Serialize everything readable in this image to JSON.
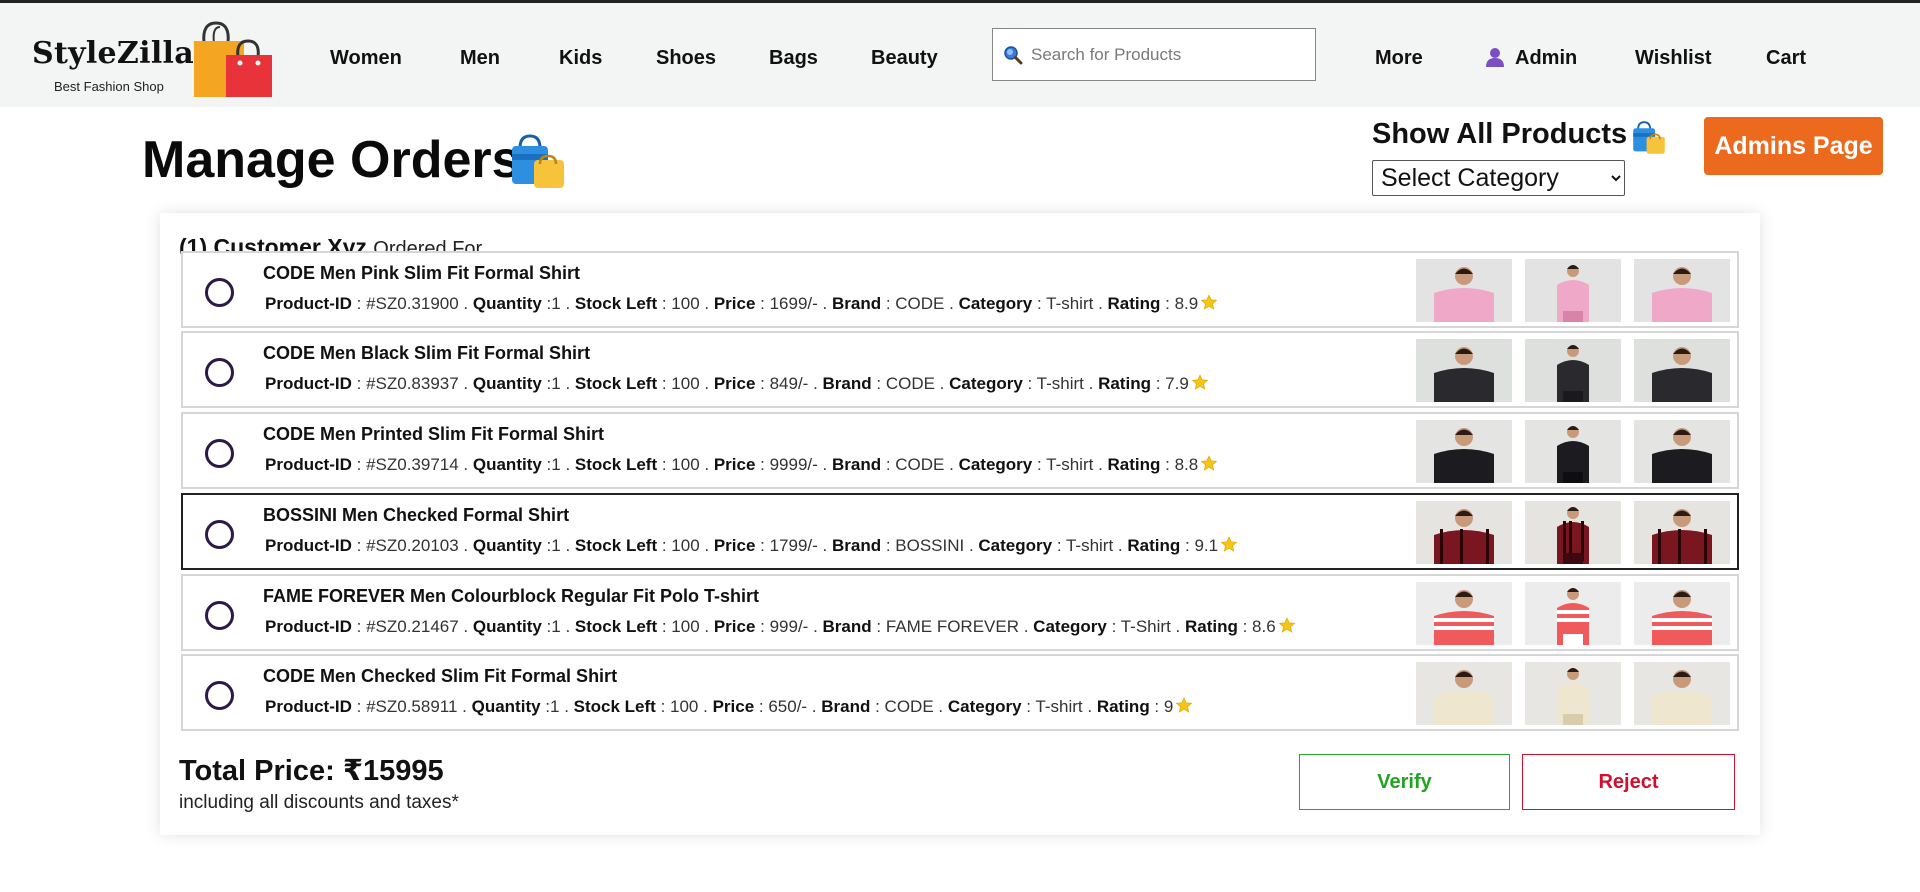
{
  "navbar": {
    "brand_name": "StyleZilla",
    "brand_tagline": "Best Fashion Shop",
    "links": {
      "women": "Women",
      "men": "Men",
      "kids": "Kids",
      "shoes": "Shoes",
      "bags": "Bags",
      "beauty": "Beauty",
      "more": "More",
      "admin": "Admin",
      "wishlist": "Wishlist",
      "cart": "Cart"
    },
    "search_placeholder": "Search for Products"
  },
  "page": {
    "title": "Manage Orders",
    "show_all": "Show All Products",
    "category_selected": "Select Category",
    "admins_button": "Admins Page"
  },
  "order": {
    "number": "(1)",
    "customer": "Customer Xyz",
    "ordered_for": "Ordered For",
    "labels": {
      "product_id": "Product-ID",
      "quantity": "Quantity",
      "stock_left": "Stock Left",
      "price": "Price",
      "brand": "Brand",
      "category": "Category",
      "rating": "Rating"
    },
    "items": [
      {
        "title": "CODE Men Pink Slim Fit Formal Shirt",
        "product_id": "#SZ0.31900",
        "quantity": "1",
        "stock_left": "100",
        "price": "1699/-",
        "brand": "CODE",
        "category": "T-shirt",
        "rating": "8.9"
      },
      {
        "title": "CODE Men Black Slim Fit Formal Shirt",
        "product_id": "#SZ0.83937",
        "quantity": "1",
        "stock_left": "100",
        "price": "849/-",
        "brand": "CODE",
        "category": "T-shirt",
        "rating": "7.9"
      },
      {
        "title": "CODE Men Printed Slim Fit Formal Shirt",
        "product_id": "#SZ0.39714",
        "quantity": "1",
        "stock_left": "100",
        "price": "9999/-",
        "brand": "CODE",
        "category": "T-shirt",
        "rating": "8.8"
      },
      {
        "title": "BOSSINI Men Checked Formal Shirt",
        "product_id": "#SZ0.20103",
        "quantity": "1",
        "stock_left": "100",
        "price": "1799/-",
        "brand": "BOSSINI",
        "category": "T-shirt",
        "rating": "9.1"
      },
      {
        "title": "FAME FOREVER Men Colourblock Regular Fit Polo T-shirt",
        "product_id": "#SZ0.21467",
        "quantity": "1",
        "stock_left": "100",
        "price": "999/-",
        "brand": "FAME FOREVER",
        "category": "T-Shirt",
        "rating": "8.6"
      },
      {
        "title": "CODE Men Checked Slim Fit Formal Shirt",
        "product_id": "#SZ0.58911",
        "quantity": "1",
        "stock_left": "100",
        "price": "650/-",
        "brand": "CODE",
        "category": "T-shirt",
        "rating": "9"
      }
    ],
    "total_label": "Total Price:",
    "total_value": "₹15995",
    "total_note": "including all discounts and taxes*",
    "verify_label": "Verify",
    "reject_label": "Reject"
  },
  "colors": {
    "admins_button": "#ec6a1d",
    "verify": "#22a322",
    "reject": "#d0102f",
    "radio": "#2b1a45",
    "star": "#f5c518"
  },
  "icons": {
    "search": "search-icon",
    "user": "user-icon",
    "star": "star-icon",
    "shopping_bags": "shopping-bags-icon"
  }
}
